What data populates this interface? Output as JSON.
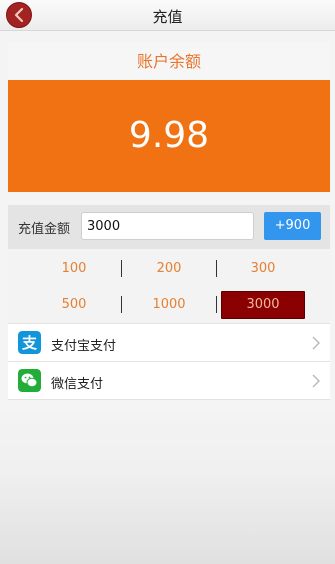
{
  "header": {
    "title": "充值"
  },
  "balance": {
    "label": "账户余额",
    "value": "9.98"
  },
  "recharge": {
    "label": "充值金额",
    "input_value": "3000",
    "plus_button": "+900"
  },
  "presets": [
    {
      "label": "100"
    },
    {
      "label": "200"
    },
    {
      "label": "300"
    },
    {
      "label": "500"
    },
    {
      "label": "1000"
    },
    {
      "label": "3000",
      "selected": true
    }
  ],
  "payment_methods": [
    {
      "label": "支付宝支付",
      "icon": "alipay-icon"
    },
    {
      "label": "微信支付",
      "icon": "wechat-icon"
    }
  ],
  "colors": {
    "accent_orange": "#f07213",
    "selected_preset": "#8b0000",
    "plus_button": "#3295ee",
    "back_button": "#a32322"
  }
}
